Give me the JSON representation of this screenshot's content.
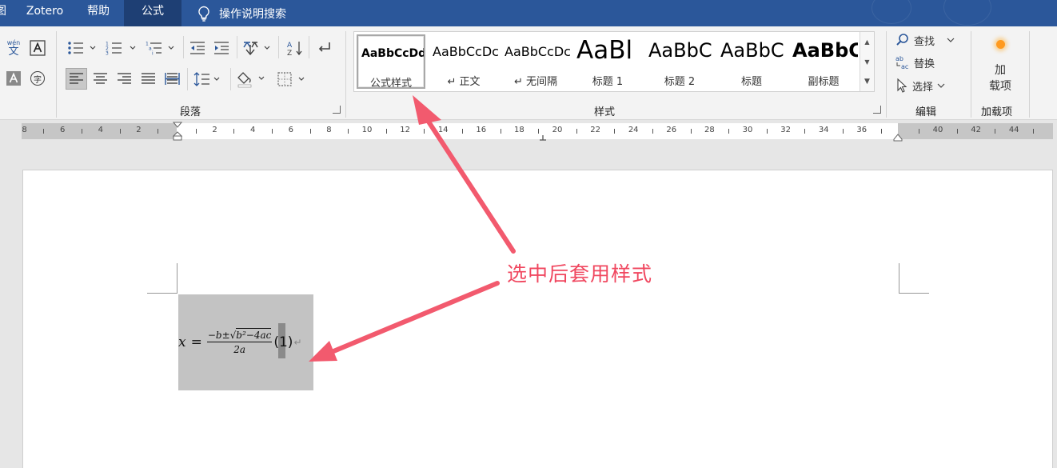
{
  "tabbar": {
    "edge_tab": "图",
    "tabs": [
      {
        "label": "Zotero"
      },
      {
        "label": "帮助"
      },
      {
        "label": "公式"
      }
    ],
    "tell_me": "操作说明搜索"
  },
  "ribbon": {
    "paragraph_group_label": "段落",
    "styles_group_label": "样式",
    "editing_group_label": "编辑",
    "addins_group_label": "加载项",
    "phonetic_glyph": "wén",
    "phonetic_char": "文",
    "enclose_char": "字",
    "styles": [
      {
        "preview": "AaBbCcDdI",
        "name": "公式样式",
        "selected": true
      },
      {
        "preview": "AaBbCcDс",
        "name": "↵ 正文",
        "selected": false
      },
      {
        "preview": "AaBbCcDс",
        "name": "↵ 无间隔",
        "selected": false
      },
      {
        "preview": "AaBl",
        "name": "标题 1",
        "selected": false
      },
      {
        "preview": "AaBbC",
        "name": "标题 2",
        "selected": false
      },
      {
        "preview": "AaBbC",
        "name": "标题",
        "selected": false
      },
      {
        "preview": "AaBbC",
        "name": "副标题",
        "selected": false
      }
    ],
    "editing": {
      "find": "查找",
      "replace": "替换",
      "select": "选择"
    },
    "addins": {
      "label_line1": "加",
      "label_line2": "载项"
    }
  },
  "ruler": {
    "labels": [
      "8",
      "6",
      "4",
      "2",
      "2",
      "4",
      "6",
      "8",
      "10",
      "12",
      "14",
      "16",
      "18",
      "20",
      "22",
      "24",
      "26",
      "28",
      "30",
      "32",
      "34",
      "36",
      "40",
      "42",
      "44"
    ]
  },
  "document": {
    "equation": {
      "lhs": "x",
      "equals": "=",
      "numerator_pre": "−b±",
      "radicand": "b²−4ac",
      "denominator": "2a",
      "number": "(1)",
      "para_mark": "↵"
    }
  },
  "annotation": {
    "text": "选中后套用样式",
    "color": "#f0475f"
  },
  "colors": {
    "tabbar": "#2b579a",
    "active_tab": "#1e3f74",
    "ribbon_bg": "#f3f3f3",
    "accent_icon": "#2b579a",
    "addin_orange": "#ff9a1f"
  }
}
